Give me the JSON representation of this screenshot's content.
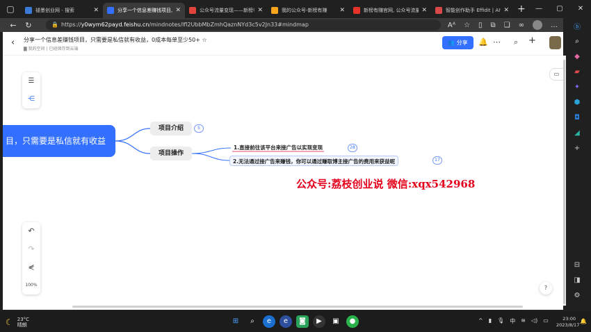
{
  "browser": {
    "tabs": [
      {
        "title": "褪墨创业网 - 搜索",
        "icon_color": "#3a7bd5",
        "active": false
      },
      {
        "title": "分享一个信息差赚钱项目,",
        "icon_color": "#3370ff",
        "active": true
      },
      {
        "title": "公众号流量变现——新榜有",
        "icon_color": "#e0443a",
        "active": false
      },
      {
        "title": "我的公众号-新榜有赚",
        "icon_color": "#f7a51c",
        "active": false
      },
      {
        "title": "新榜有赚官网, 公众号流量",
        "icon_color": "#e5332a",
        "active": false
      },
      {
        "title": "智能创作助手 Effidit | AI智能",
        "icon_color": "#d84a4a",
        "active": false
      }
    ],
    "url_prefix": "https://",
    "url_host": "y0wym62payd.feishu.cn",
    "url_path": "/mindnotes/lfl2UbbMbZmhQaznNYd3c5v2Jn33#mindmap",
    "icons": [
      "back-icon",
      "refresh-icon",
      "lock-icon",
      "read-aloud-icon",
      "favorite-icon",
      "split-screen-icon",
      "extensions-icon",
      "collections-icon",
      "copilot-icon",
      "profile-icon",
      "more-icon"
    ]
  },
  "doc": {
    "title": "分享一个信息差赚钱项目，只需要是私信就有收益，0成本每单至少50+",
    "location": "我的空间",
    "save_status": "已经保存到云端",
    "share_label": "分享"
  },
  "mindmap": {
    "root": "目，只需要是私信就有收益",
    "nodes": [
      {
        "label": "项目介绍",
        "count": "5"
      },
      {
        "label": "项目操作",
        "count": ""
      }
    ],
    "leaves": [
      {
        "label": "1.直接前往该平台来接广告以实现变现",
        "count": "28"
      },
      {
        "label": "2.无法通过接广告来赚钱，你可以通过赚取博主接广告的费用来获益呢",
        "count": "17"
      }
    ],
    "watermark": "公众号:荔枝创业说  微信:xqx542968",
    "zoom": "100%"
  },
  "taskbar": {
    "temperature": "23°C",
    "weather": "晴朗",
    "time": "23:00",
    "date": "2023/8/17",
    "ime": "中"
  }
}
